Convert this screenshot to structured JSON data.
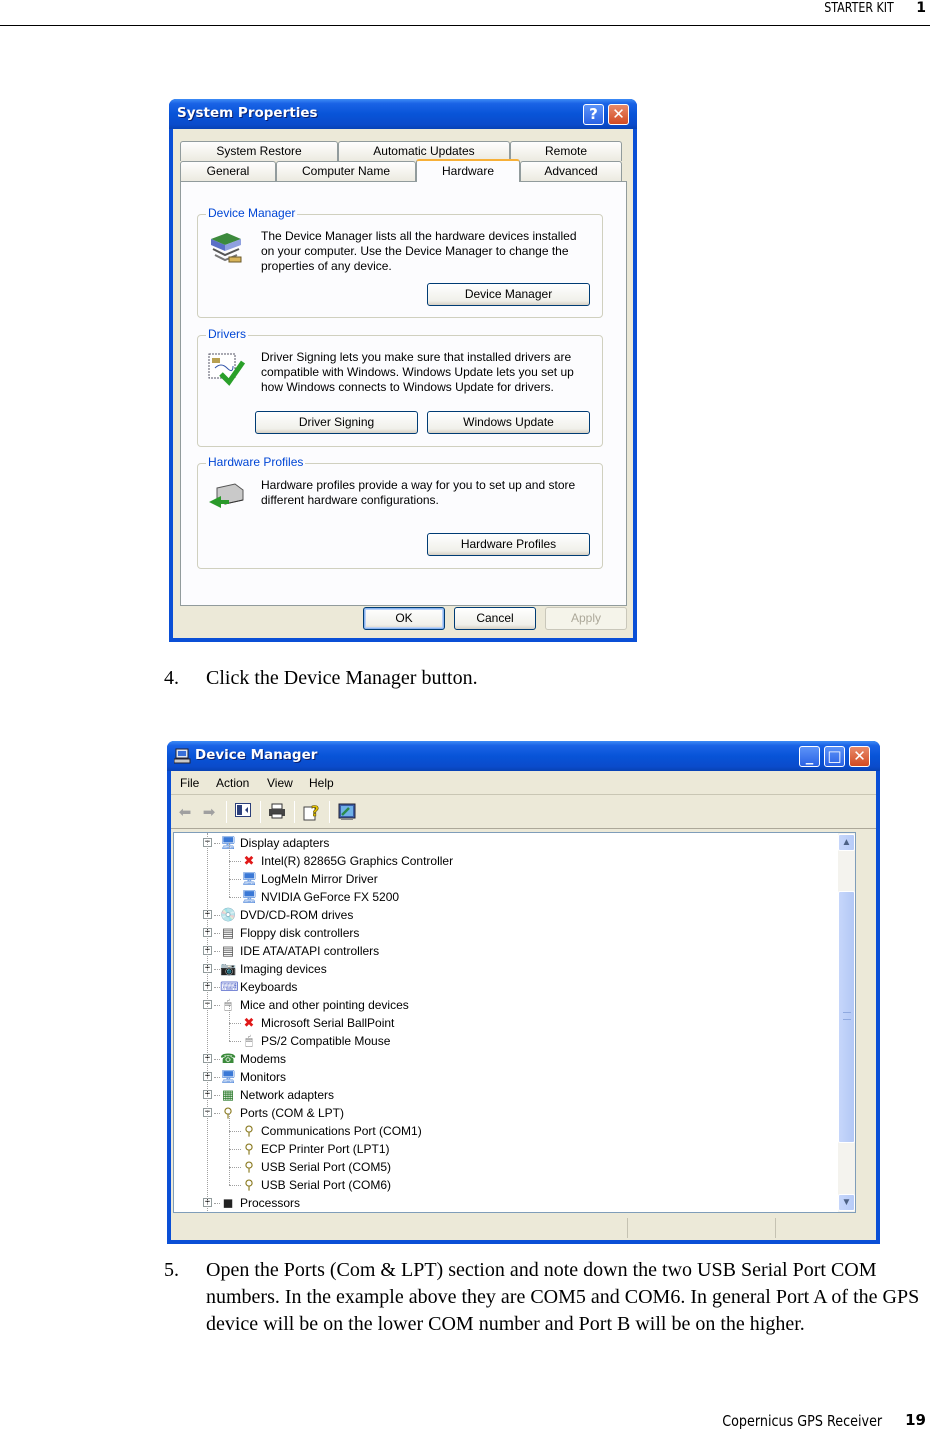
{
  "page": {
    "header": {
      "section": "STARTER KIT",
      "chapter": "1"
    },
    "footer": {
      "title": "Copernicus GPS Receiver",
      "page_number": "19"
    }
  },
  "steps": [
    {
      "number": "4.",
      "text": "Click the Device Manager button."
    },
    {
      "number": "5.",
      "text": "Open the Ports (Com & LPT) section and note down the two USB Serial Port COM numbers. In the example above they are COM5 and COM6. In general Port A of the GPS device will be on the lower COM number and Port B will be on the higher."
    }
  ],
  "system_properties": {
    "title": "System Properties",
    "title_buttons": {
      "help": "?",
      "close": "✕"
    },
    "tabs_back_row": [
      "System Restore",
      "Automatic Updates",
      "Remote"
    ],
    "tabs_front_row": [
      "General",
      "Computer Name",
      "Hardware",
      "Advanced"
    ],
    "active_tab": "Hardware",
    "groups": {
      "device_manager": {
        "legend": "Device Manager",
        "description": "The Device Manager lists all the hardware devices installed on your computer. Use the Device Manager to change the properties of any device.",
        "button": "Device Manager"
      },
      "drivers": {
        "legend": "Drivers",
        "description": "Driver Signing lets you make sure that installed drivers are compatible with Windows. Windows Update lets you set up how Windows connects to Windows Update for drivers.",
        "buttons": [
          "Driver Signing",
          "Windows Update"
        ]
      },
      "hardware_profiles": {
        "legend": "Hardware Profiles",
        "description": "Hardware profiles provide a way for you to set up and store different hardware configurations.",
        "button": "Hardware Profiles"
      }
    },
    "footer_buttons": {
      "ok": "OK",
      "cancel": "Cancel",
      "apply": "Apply"
    }
  },
  "device_manager": {
    "title": "Device Manager",
    "title_buttons": {
      "minimize": "_",
      "maximize": "□",
      "close": "✕"
    },
    "menu": [
      "File",
      "Action",
      "View",
      "Help"
    ],
    "toolbar": [
      "back",
      "forward",
      "show-hide-console-tree",
      "print",
      "help",
      "properties"
    ],
    "tree": [
      {
        "label": "Display adapters",
        "level": 0,
        "expanded": true,
        "icon": "monitor-icon"
      },
      {
        "label": "Intel(R) 82865G Graphics Controller",
        "level": 1,
        "icon": "disabled-device-icon",
        "status": "disabled"
      },
      {
        "label": "LogMeIn Mirror Driver",
        "level": 1,
        "icon": "monitor-icon"
      },
      {
        "label": "NVIDIA GeForce FX 5200",
        "level": 1,
        "icon": "monitor-icon"
      },
      {
        "label": "DVD/CD-ROM drives",
        "level": 0,
        "expanded": false,
        "icon": "cd-drive-icon"
      },
      {
        "label": "Floppy disk controllers",
        "level": 0,
        "expanded": false,
        "icon": "controller-icon"
      },
      {
        "label": "IDE ATA/ATAPI controllers",
        "level": 0,
        "expanded": false,
        "icon": "controller-icon"
      },
      {
        "label": "Imaging devices",
        "level": 0,
        "expanded": false,
        "icon": "camera-icon"
      },
      {
        "label": "Keyboards",
        "level": 0,
        "expanded": false,
        "icon": "keyboard-icon"
      },
      {
        "label": "Mice and other pointing devices",
        "level": 0,
        "expanded": true,
        "icon": "mouse-icon"
      },
      {
        "label": "Microsoft Serial BallPoint",
        "level": 1,
        "icon": "disabled-device-icon",
        "status": "disabled"
      },
      {
        "label": "PS/2 Compatible Mouse",
        "level": 1,
        "icon": "mouse-icon"
      },
      {
        "label": "Modems",
        "level": 0,
        "expanded": false,
        "icon": "modem-icon"
      },
      {
        "label": "Monitors",
        "level": 0,
        "expanded": false,
        "icon": "monitor-icon"
      },
      {
        "label": "Network adapters",
        "level": 0,
        "expanded": false,
        "icon": "network-card-icon"
      },
      {
        "label": "Ports (COM & LPT)",
        "level": 0,
        "expanded": true,
        "icon": "port-icon"
      },
      {
        "label": "Communications Port (COM1)",
        "level": 1,
        "icon": "port-icon"
      },
      {
        "label": "ECP Printer Port (LPT1)",
        "level": 1,
        "icon": "port-icon"
      },
      {
        "label": "USB Serial Port (COM5)",
        "level": 1,
        "icon": "port-icon"
      },
      {
        "label": "USB Serial Port (COM6)",
        "level": 1,
        "icon": "port-icon"
      },
      {
        "label": "Processors",
        "level": 0,
        "expanded": false,
        "icon": "processor-icon"
      }
    ],
    "scrollbar": {
      "up": "▲",
      "down": "▼"
    }
  },
  "colors": {
    "xp_title_blue": "#0854d8",
    "dialog_face": "#ece9d8",
    "group_legend": "#0046d5",
    "active_tab_accent": "#f7b038",
    "close_button_red": "#d24a22",
    "scroll_thumb": "#c6d6fb"
  }
}
